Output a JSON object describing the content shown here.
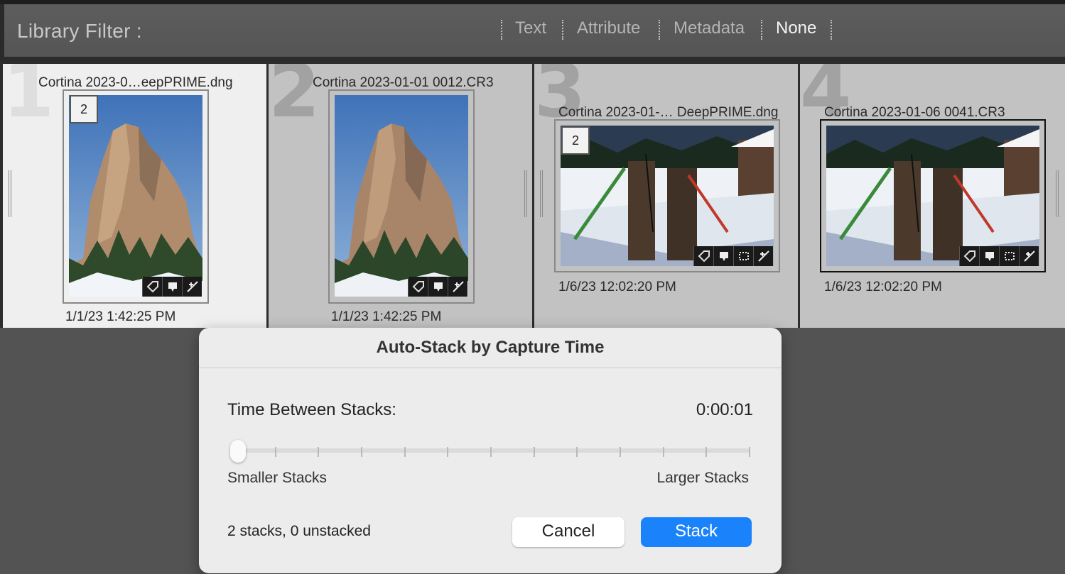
{
  "filter_bar": {
    "title": "Library Filter :",
    "tabs": [
      {
        "label": "Text",
        "active": false
      },
      {
        "label": "Attribute",
        "active": false
      },
      {
        "label": "Metadata",
        "active": false
      },
      {
        "label": "None",
        "active": true
      }
    ]
  },
  "grid": {
    "cells": [
      {
        "index": "1",
        "filename": "Cortina 2023-0…eepPRIME.dng",
        "stack_count": "2",
        "date": "1/1/23 1:42:25 PM",
        "selected": true
      },
      {
        "index": "2",
        "filename": "Cortina 2023-01-01 0012.CR3",
        "stack_count": "",
        "date": "1/1/23 1:42:25 PM",
        "selected": false
      },
      {
        "index": "3",
        "filename": "Cortina 2023-01-…  DeepPRIME.dng",
        "stack_count": "2",
        "date": "1/6/23 12:02:20 PM",
        "selected": false
      },
      {
        "index": "4",
        "filename": "Cortina 2023-01-06 0041.CR3",
        "stack_count": "",
        "date": "1/6/23 12:02:20 PM",
        "selected": false
      }
    ],
    "badge_icons": [
      "keyword-tag-icon",
      "comment-icon",
      "crop-icon",
      "develop-adjust-icon"
    ]
  },
  "dialog": {
    "title": "Auto-Stack by Capture Time",
    "time_label": "Time Between Stacks:",
    "time_value": "0:00:01",
    "slider_position": 0.0,
    "slider_tick_count": 13,
    "min_label": "Smaller Stacks",
    "max_label": "Larger Stacks",
    "summary": "2 stacks, 0 unstacked",
    "cancel_label": "Cancel",
    "stack_label": "Stack"
  },
  "colors": {
    "accent": "#1a82fb",
    "selected_cell": "#efefef",
    "cell": "#c2c2c2"
  }
}
